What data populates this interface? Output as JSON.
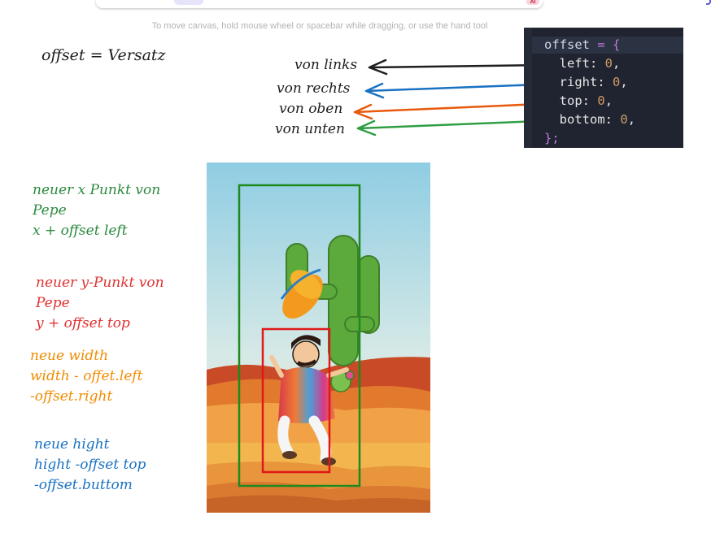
{
  "toolbar": {
    "badge": "AI"
  },
  "canvas_hint": "To move canvas, hold mouse wheel or spacebar while dragging, or use the hand tool",
  "title": "offset = Versatz",
  "arrow_labels": [
    {
      "text": "von links",
      "color": "#1e1e1e"
    },
    {
      "text": "von rechts",
      "color": "#1971c2"
    },
    {
      "text": "von oben",
      "color": "#e8590c"
    },
    {
      "text": "von unten",
      "color": "#2f9e44"
    }
  ],
  "code": {
    "line1_var": "offset",
    "line1_op": " = {",
    "props": [
      {
        "key": "left",
        "value": "0"
      },
      {
        "key": "right",
        "value": "0"
      },
      {
        "key": "top",
        "value": "0"
      },
      {
        "key": "bottom",
        "value": "0"
      }
    ],
    "closing": "};"
  },
  "notes": {
    "x": [
      "neuer x Punkt von",
      "Pepe",
      "x + offset left"
    ],
    "y": [
      "neuer y-Punkt von",
      "Pepe",
      "y + offset top"
    ],
    "width": [
      "neue width",
      "width - offet.left",
      "-offset.right"
    ],
    "height": [
      "neue hight",
      "hight -offset top",
      "-offset.buttom"
    ]
  },
  "colors": {
    "green_box": "#1e8a1e",
    "red_box": "#e01818",
    "sky_top": "#a6d6e6",
    "desert": "#e89a45"
  }
}
